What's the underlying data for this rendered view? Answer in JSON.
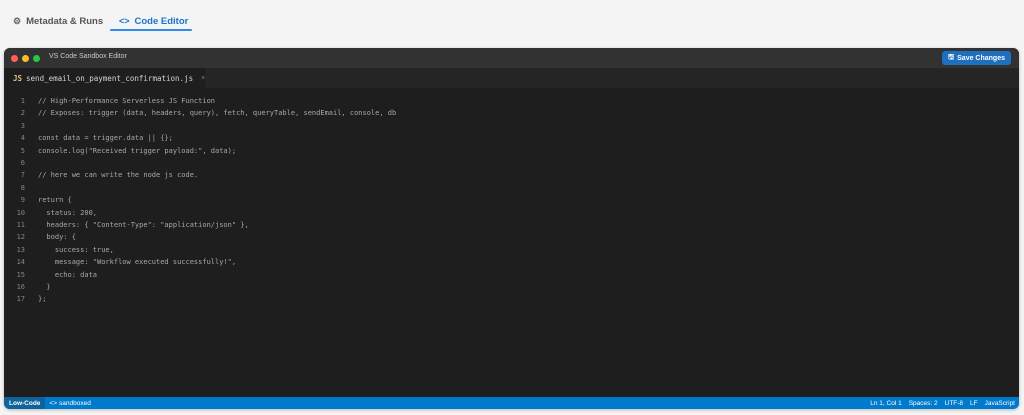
{
  "top_tabs": {
    "metadata": {
      "icon": "gear-icon",
      "label": "Metadata & Runs"
    },
    "code_editor": {
      "icon": "code-icon",
      "label": "Code Editor",
      "active_color": "#1a73c8"
    }
  },
  "editor": {
    "window_title": "VS Code Sandbox Editor",
    "save_button": {
      "icon": "save-icon",
      "label": "Save Changes"
    },
    "file_tab": {
      "badge": "JS",
      "filename": "send_email_on_payment_confirmation.js",
      "close": "×"
    },
    "lines": [
      {
        "n": "1",
        "text": "// High-Performance Serverless JS Function"
      },
      {
        "n": "2",
        "text": "// Exposes: trigger (data, headers, query), fetch, queryTable, sendEmail, console, db"
      },
      {
        "n": "3",
        "text": ""
      },
      {
        "n": "4",
        "text": "const data = trigger.data || {};"
      },
      {
        "n": "5",
        "text": "console.log(\"Received trigger payload:\", data);"
      },
      {
        "n": "6",
        "text": ""
      },
      {
        "n": "7",
        "text": "// here we can write the node js code."
      },
      {
        "n": "8",
        "text": ""
      },
      {
        "n": "9",
        "text": "return {"
      },
      {
        "n": "10",
        "text": "  status: 200,"
      },
      {
        "n": "11",
        "text": "  headers: { \"Content-Type\": \"application/json\" },"
      },
      {
        "n": "12",
        "text": "  body: {"
      },
      {
        "n": "13",
        "text": "    success: true,"
      },
      {
        "n": "14",
        "text": "    message: \"Workflow executed successfully!\","
      },
      {
        "n": "15",
        "text": "    echo: data"
      },
      {
        "n": "16",
        "text": "  }"
      },
      {
        "n": "17",
        "text": "};"
      }
    ],
    "status": {
      "mode": "Low-Code",
      "sandboxed": "sandboxed",
      "position": "Ln 1, Col 1",
      "spaces": "Spaces: 2",
      "encoding": "UTF-8",
      "eol": "LF",
      "language": "JavaScript"
    },
    "colors": {
      "status_bar": "#007acc",
      "save_button": "#1f6fbf",
      "background": "#1e1e1e"
    }
  }
}
